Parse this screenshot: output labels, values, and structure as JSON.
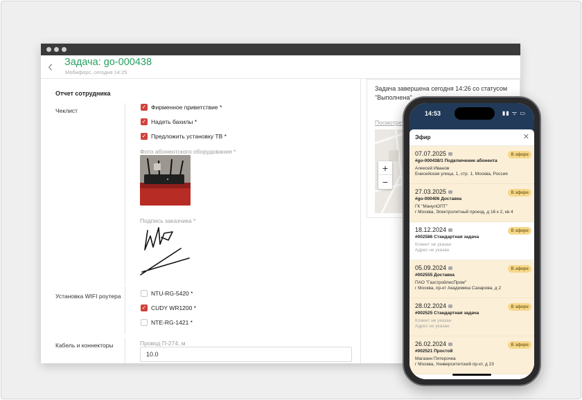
{
  "window": {
    "title": "Задача: go-000438",
    "subtitle": "Мобифорс, сегодня 14:25"
  },
  "report": {
    "heading": "Отчет сотрудника",
    "checklist_label": "Чеклист",
    "checklist": [
      {
        "label": "Фирменное приветствие *",
        "checked": true
      },
      {
        "label": "Надеть бахилы *",
        "checked": true
      },
      {
        "label": "Предложить установку ТВ *",
        "checked": true
      }
    ],
    "photo_label": "Фото абонентского оборудования *",
    "signature_label": "Подпись заказчика *",
    "wifi_label": "Установка WIFI роутера",
    "wifi_options": [
      {
        "label": "NTU-RG-5420 *",
        "checked": false
      },
      {
        "label": "CUDY WR1200 *",
        "checked": true
      },
      {
        "label": "NTE-RG-1421 *",
        "checked": false
      }
    ],
    "cable_label": "Кабель и коннекторы",
    "wire_label": "Провод П-274, м",
    "wire_value": "10.0"
  },
  "right_panel": {
    "status_text": "Задача завершена сегодня 14:26 со статусом \"Выполнена\"",
    "map_link": "Посмотреть на карте",
    "zoom_in": "+",
    "zoom_out": "−"
  },
  "phone": {
    "time": "14:53",
    "status_icons": "▮▮ ᯤ ▭",
    "sheet_title": "Эфир",
    "close": "✕",
    "cards": [
      {
        "date": "07.07.2025",
        "number": "#go-000438/1 Подключение абонента",
        "client": "Алексей Иванов",
        "address": "Енисейская улица, 1, стр. 1, Москва, Россия",
        "badge": "В эфире",
        "highlight": true,
        "muted": false
      },
      {
        "date": "27.03.2025",
        "number": "#go-000406 Доставка",
        "client": "ГК \"МанулОПТ\"",
        "address": "г Москва, Электролитный проезд, д 16 к 2, кв 4",
        "badge": "В эфире",
        "highlight": true,
        "muted": false
      },
      {
        "date": "18.12.2024",
        "number": "#002586 Стандартная задача",
        "client": "Клиент не указан",
        "address": "Адрес не указан",
        "badge": "В эфире",
        "highlight": false,
        "muted": true
      },
      {
        "date": "05.09.2024",
        "number": "#002555 Доставка",
        "client": "ПАО \"ГазстройлесПром\"",
        "address": "г Москва, пр-кт Академика Сахарова, д 2",
        "badge": "В эфире",
        "highlight": true,
        "muted": false
      },
      {
        "date": "28.02.2024",
        "number": "#002525 Стандартная задача",
        "client": "Клиент не указан",
        "address": "Адрес не указан",
        "badge": "В эфире",
        "highlight": true,
        "muted": true
      },
      {
        "date": "26.02.2024",
        "number": "#002521 Простой",
        "client": "Магазин Пятерочка",
        "address": "г Москва, Университетский пр-кт, д 23",
        "badge": "В эфире",
        "highlight": true,
        "muted": false
      }
    ]
  },
  "colors": {
    "accent_green": "#27a060",
    "checkbox_red": "#d0433c",
    "badge_yellow": "#f6d88b",
    "card_highlight": "#fbefd8",
    "phone_header": "#213a59"
  }
}
